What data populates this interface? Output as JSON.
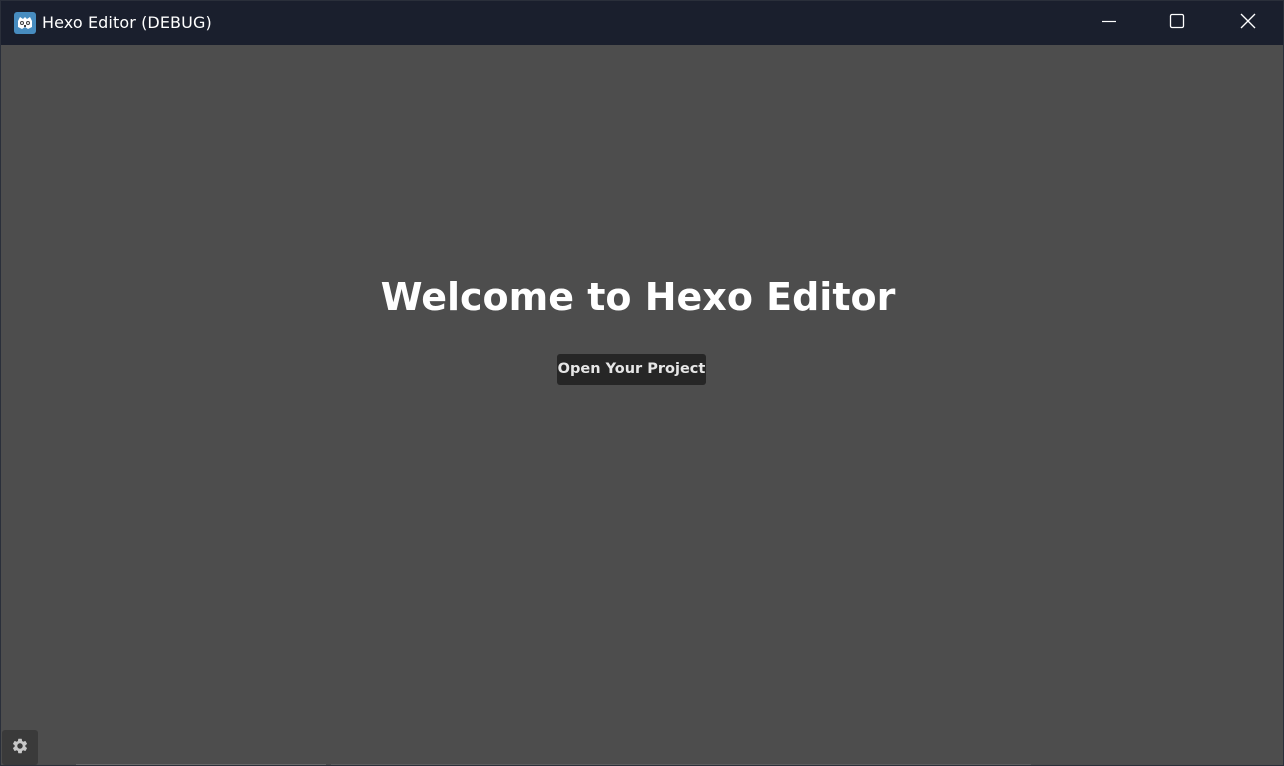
{
  "window": {
    "title": "Hexo Editor (DEBUG)",
    "app_icon": "godot-engine-icon",
    "controls": {
      "minimize_icon": "minimize-icon",
      "maximize_icon": "maximize-icon",
      "close_icon": "close-icon"
    }
  },
  "main": {
    "heading": "Welcome to Hexo Editor",
    "open_project_label": "Open Your Project"
  },
  "footer": {
    "settings_icon": "gear-icon"
  },
  "colors": {
    "titlebar_bg": "#1a1f2d",
    "content_bg": "#4d4d4d",
    "button_bg": "#262626",
    "text": "#ffffff"
  }
}
